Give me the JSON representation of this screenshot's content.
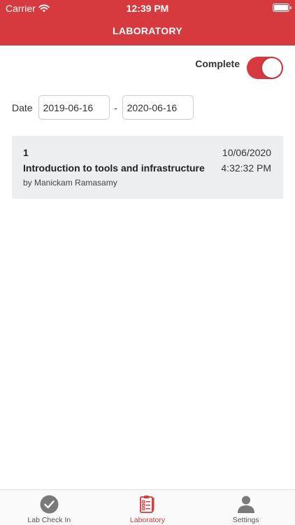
{
  "status_bar": {
    "carrier": "Carrier",
    "time": "12:39 PM"
  },
  "header": {
    "title": "LABORATORY"
  },
  "filter": {
    "complete_label": "Complete",
    "complete_on": true,
    "date_label": "Date",
    "date_from": "2019-06-16",
    "date_separator": "-",
    "date_to": "2020-06-16"
  },
  "records": [
    {
      "number": "1",
      "title": "Introduction to tools and infrastructure",
      "author": "by Manickam Ramasamy",
      "date": "10/06/2020",
      "time": "4:32:32 PM"
    }
  ],
  "tabs": [
    {
      "label": "Lab Check In",
      "icon": "checkmark-circle-icon",
      "active": false
    },
    {
      "label": "Laboratory",
      "icon": "clipboard-checklist-icon",
      "active": true
    },
    {
      "label": "Settings",
      "icon": "person-icon",
      "active": false
    }
  ],
  "colors": {
    "accent": "#d63a3f",
    "card_background": "#eceeef"
  }
}
